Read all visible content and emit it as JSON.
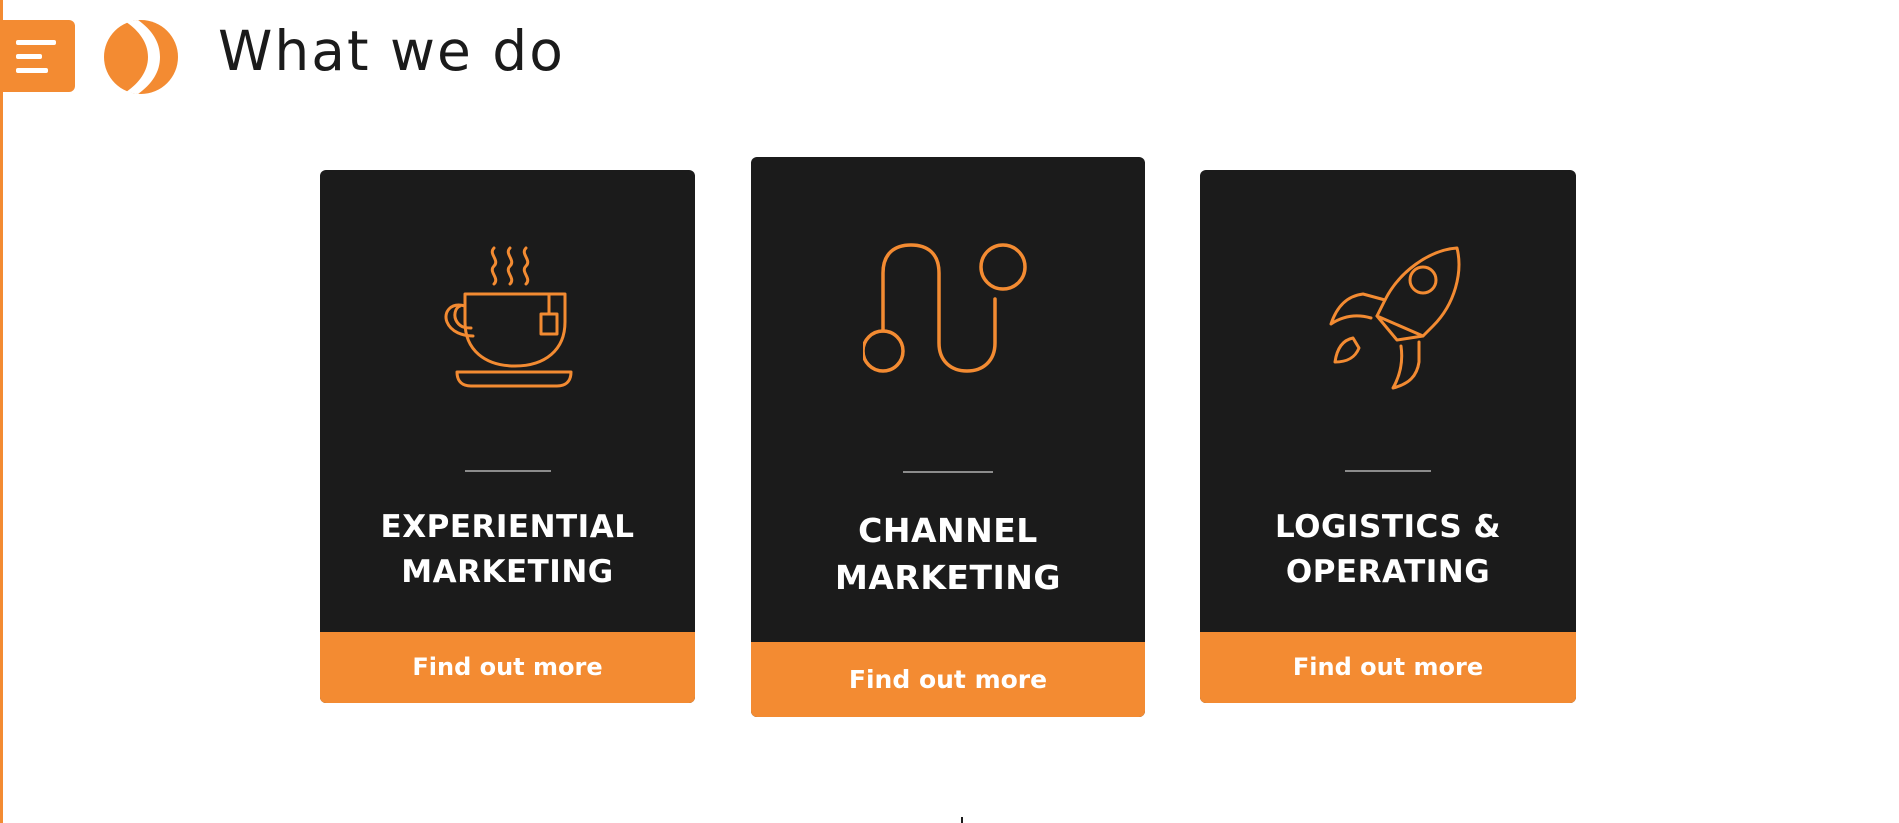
{
  "header": {
    "menu_icon": "hamburger-menu-icon",
    "logo_icon": "chevron-logo-icon",
    "title": "What we do"
  },
  "colors": {
    "accent": "#f38b32",
    "card_background": "#1b1b1b",
    "card_text": "#ffffff",
    "title_text": "#1b1b1b",
    "divider": "#8c8c8c"
  },
  "cards": [
    {
      "icon": "teacup-icon",
      "title_line1": "EXPERIENTIAL",
      "title_line2": "MARKETING",
      "cta": "Find out more"
    },
    {
      "icon": "route-path-icon",
      "title_line1": "CHANNEL",
      "title_line2": "MARKETING",
      "cta": "Find out more"
    },
    {
      "icon": "rocket-icon",
      "title_line1": "LOGISTICS &",
      "title_line2": "OPERATING",
      "cta": "Find out more"
    }
  ]
}
